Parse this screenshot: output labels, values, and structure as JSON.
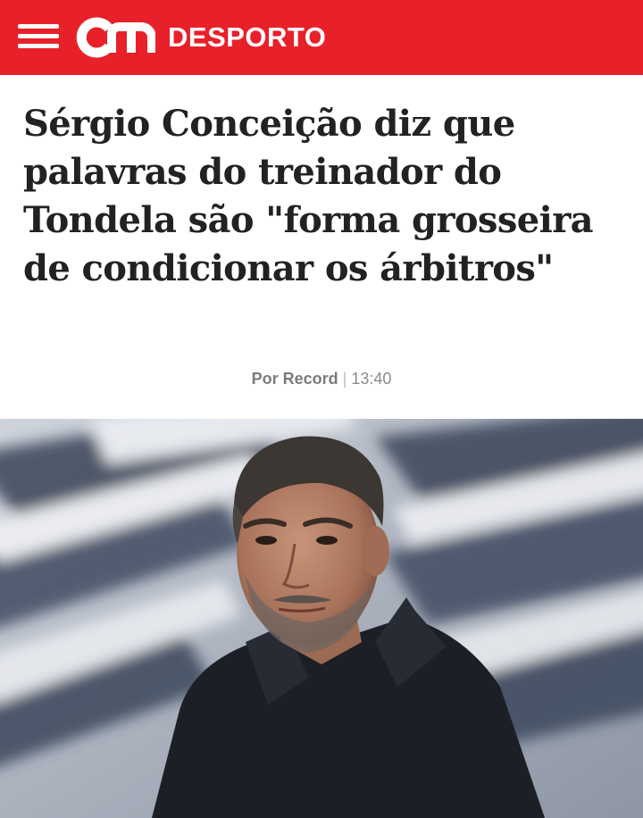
{
  "header": {
    "menu_icon": "hamburger-menu-icon",
    "logo_text": "cm",
    "section": "DESPORTO",
    "brand_color": "#e8202a"
  },
  "article": {
    "headline": "Sérgio Conceição diz que palavras do treinador do Tondela são \"forma grosseira de condicionar os árbitros\"",
    "author": "Por Record",
    "separator": "|",
    "time": "13:40"
  },
  "photo": {
    "icon": "article-photo"
  }
}
